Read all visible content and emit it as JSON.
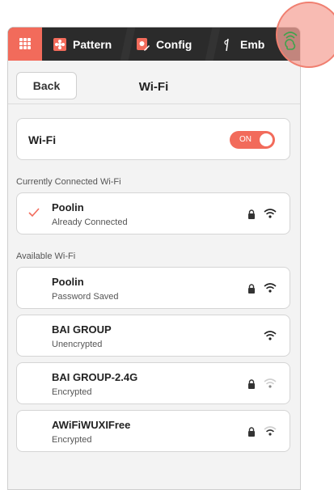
{
  "topbar": {
    "tabs": [
      {
        "label": "Pattern",
        "icon": "flower-icon"
      },
      {
        "label": "Config",
        "icon": "config-edit-icon"
      },
      {
        "label": "Emb",
        "icon": "needle-icon"
      }
    ],
    "accent": "#f26b5b"
  },
  "header": {
    "back_label": "Back",
    "title": "Wi-Fi"
  },
  "wifi": {
    "label": "Wi-Fi",
    "toggle_label": "ON"
  },
  "connected": {
    "section_label": "Currently Connected Wi-Fi",
    "name": "Poolin",
    "status": "Already Connected"
  },
  "available": {
    "section_label": "Available Wi-Fi",
    "networks": [
      {
        "name": "Poolin",
        "status": "Password Saved",
        "locked": true,
        "signal": "strong"
      },
      {
        "name": "BAI GROUP",
        "status": "Unencrypted",
        "locked": false,
        "signal": "strong"
      },
      {
        "name": "BAI GROUP-2.4G",
        "status": "Encrypted",
        "locked": true,
        "signal": "weak"
      },
      {
        "name": "AWiFiWUXIFree",
        "status": "Encrypted",
        "locked": true,
        "signal": "medium"
      }
    ]
  }
}
